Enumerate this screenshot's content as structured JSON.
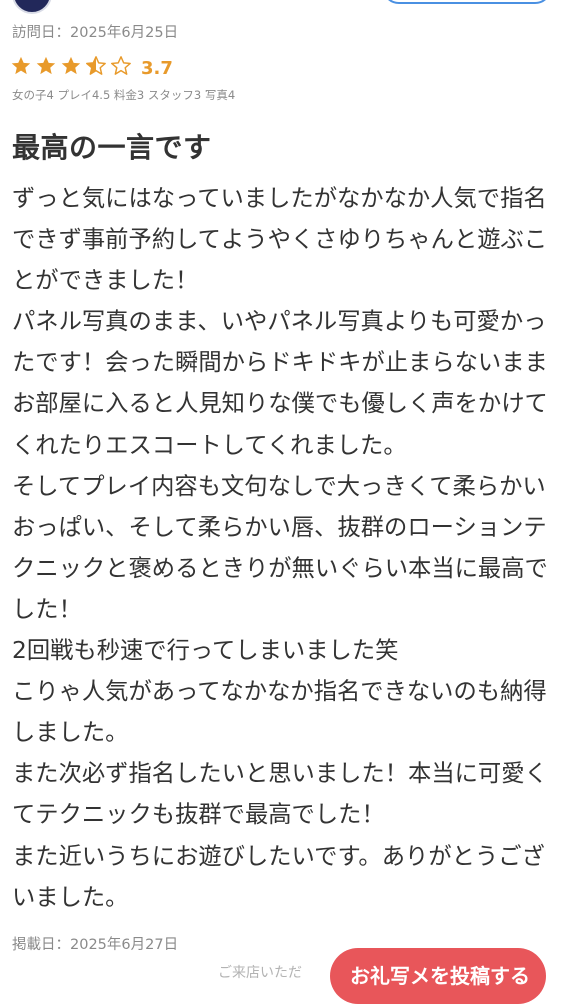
{
  "review": {
    "visit_date": "訪問日：2025年6月25日",
    "rating": {
      "stars": 3.5,
      "max_stars": 5,
      "value_text": "3.7",
      "color": "#e89a2b"
    },
    "sub_ratings": "女の子4 プレイ4.5 料金3 スタッフ3 写真4",
    "title": "最高の一言です",
    "body_lines": [
      "ずっと気にはなっていましたがなかなか人気で指名",
      "できず事前予約してようやくさゆりちゃんと遊ぶこ",
      "とができました！",
      "パネル写真のまま、いやパネル写真よりも可愛かっ",
      "たです！会った瞬間からドキドキが止まらないまま",
      "お部屋に入ると人見知りな僕でも優しく声をかけて",
      "くれたりエスコートしてくれました。",
      "そしてプレイ内容も文句なしで大っきくて柔らかい",
      "おっぱい、そして柔らかい唇、抜群のローションテ",
      "クニックと褒めるときりが無いぐらい本当に最高で",
      "した！",
      "2回戦も秒速で行ってしまいました笑",
      "こりゃ人気があってなかなか指名できないのも納得",
      "しました。",
      "また次必ず指名したいと思いました！本当に可愛く",
      "てテクニックも抜群で最高でした！",
      "また近いうちにお遊びしたいです。ありがとうござ",
      "いました。"
    ],
    "posted_date": "掲載日：2025年6月27日"
  },
  "footer": {
    "faded_text": "ご来店いただ",
    "post_photo_button": "お礼写メを投稿する"
  },
  "colors": {
    "star": "#e89a2b",
    "star_empty_outline": "#e89a2b",
    "button_bg": "#e8565a",
    "meta_text": "#8a8a8a",
    "body_text": "#333333"
  },
  "icons": {
    "star": "star-icon",
    "half_star": "half-star-icon",
    "empty_star": "empty-star-icon"
  }
}
